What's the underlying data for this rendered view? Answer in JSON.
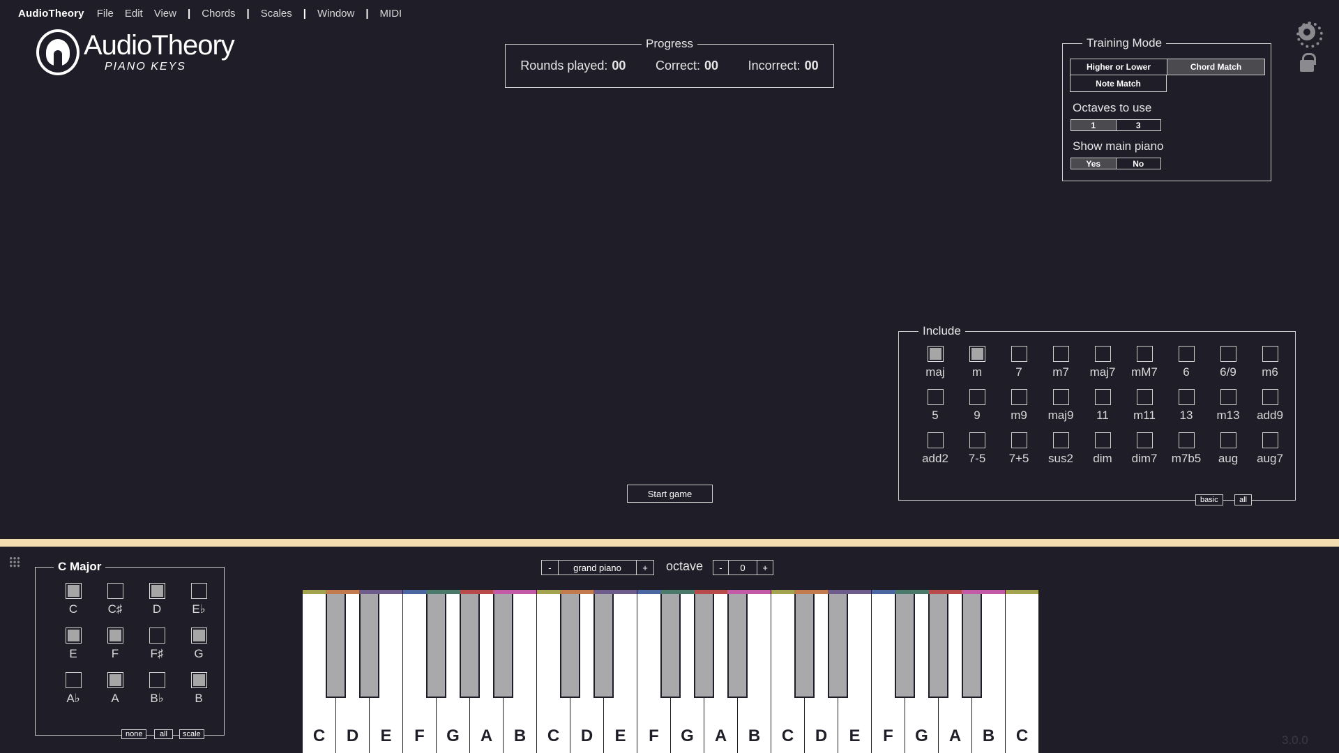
{
  "menu": {
    "app": "AudioTheory",
    "items": [
      "File",
      "Edit",
      "View",
      "Chords",
      "Scales",
      "Window",
      "MIDI"
    ],
    "separator": "|"
  },
  "logo": {
    "brand": "AudioTheory",
    "subtitle": "PIANO KEYS"
  },
  "progress": {
    "legend": "Progress",
    "rounds_label": "Rounds played:",
    "rounds": "00",
    "correct_label": "Correct:",
    "correct": "00",
    "incorrect_label": "Incorrect:",
    "incorrect": "00"
  },
  "training": {
    "legend": "Training Mode",
    "modes": [
      {
        "label": "Higher or Lower",
        "selected": false
      },
      {
        "label": "Chord Match",
        "selected": true
      },
      {
        "label": "Note Match",
        "selected": false
      }
    ],
    "octaves_label": "Octaves to use",
    "octaves": [
      {
        "label": "1",
        "selected": true
      },
      {
        "label": "3",
        "selected": false
      }
    ],
    "show_piano_label": "Show main piano",
    "show_piano": [
      {
        "label": "Yes",
        "selected": true
      },
      {
        "label": "No",
        "selected": false
      }
    ]
  },
  "icons": {
    "settings": "gear-icon",
    "lock": "lock-icon",
    "grid": "grid-icon"
  },
  "include": {
    "legend": "Include",
    "chords": [
      {
        "label": "maj",
        "checked": true
      },
      {
        "label": "m",
        "checked": true
      },
      {
        "label": "7",
        "checked": false
      },
      {
        "label": "m7",
        "checked": false
      },
      {
        "label": "maj7",
        "checked": false
      },
      {
        "label": "mM7",
        "checked": false
      },
      {
        "label": "6",
        "checked": false
      },
      {
        "label": "6/9",
        "checked": false
      },
      {
        "label": "m6",
        "checked": false
      },
      {
        "label": "5",
        "checked": false
      },
      {
        "label": "9",
        "checked": false
      },
      {
        "label": "m9",
        "checked": false
      },
      {
        "label": "maj9",
        "checked": false
      },
      {
        "label": "11",
        "checked": false
      },
      {
        "label": "m11",
        "checked": false
      },
      {
        "label": "13",
        "checked": false
      },
      {
        "label": "m13",
        "checked": false
      },
      {
        "label": "add9",
        "checked": false
      },
      {
        "label": "add2",
        "checked": false
      },
      {
        "label": "7-5",
        "checked": false
      },
      {
        "label": "7+5",
        "checked": false
      },
      {
        "label": "sus2",
        "checked": false
      },
      {
        "label": "dim",
        "checked": false
      },
      {
        "label": "dim7",
        "checked": false
      },
      {
        "label": "m7b5",
        "checked": false
      },
      {
        "label": "aug",
        "checked": false
      },
      {
        "label": "aug7",
        "checked": false
      }
    ],
    "basic_label": "basic",
    "all_label": "all"
  },
  "start_label": "Start game",
  "scale": {
    "legend": "C Major",
    "notes": [
      {
        "label": "C",
        "checked": true
      },
      {
        "label": "C♯",
        "checked": false
      },
      {
        "label": "D",
        "checked": true
      },
      {
        "label": "E♭",
        "checked": false
      },
      {
        "label": "E",
        "checked": true
      },
      {
        "label": "F",
        "checked": true
      },
      {
        "label": "F♯",
        "checked": false
      },
      {
        "label": "G",
        "checked": true
      },
      {
        "label": "A♭",
        "checked": false
      },
      {
        "label": "A",
        "checked": true
      },
      {
        "label": "B♭",
        "checked": false
      },
      {
        "label": "B",
        "checked": true
      }
    ],
    "none_label": "none",
    "all_label": "all",
    "scale_label": "scale"
  },
  "instrument": {
    "minus": "-",
    "plus": "+",
    "name": "grand piano"
  },
  "octave": {
    "label": "octave",
    "minus": "-",
    "plus": "+",
    "value": "0"
  },
  "piano": {
    "white_keys": [
      "C",
      "D",
      "E",
      "F",
      "G",
      "A",
      "B",
      "C",
      "D",
      "E",
      "F",
      "G",
      "A",
      "B",
      "C",
      "D",
      "E",
      "F",
      "G",
      "A",
      "B",
      "C"
    ],
    "colors": {
      "C": "#a3a24e",
      "C#": "#c27b4e",
      "D": "#c27b4e",
      "D#": "#6e5d8c",
      "E": "#6e5d8c",
      "F": "#4a67a1",
      "F#": "#4a7a6a",
      "G": "#4a7a6a",
      "G#": "#b84a4a",
      "A": "#b84a4a",
      "A#": "#c35aa8",
      "B": "#c35aa8"
    }
  },
  "version": "3.0.0"
}
